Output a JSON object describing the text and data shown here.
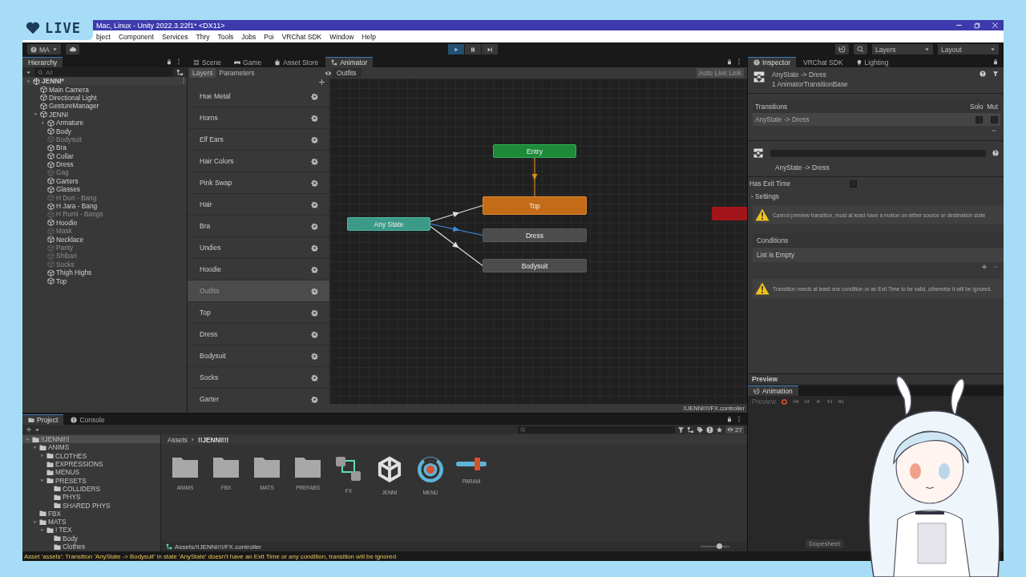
{
  "overlay": {
    "badge": "LIVE"
  },
  "window": {
    "title": "Mac, Linux - Unity 2022.3.22f1* <DX11>"
  },
  "menu": [
    "bject",
    "Component",
    "Services",
    "Thry",
    "Tools",
    "Jobs",
    "Poi",
    "VRChat SDK",
    "Window",
    "Help"
  ],
  "toolbar": {
    "account": "MA",
    "playing": true,
    "layers": "Layers",
    "layout": "Layout"
  },
  "hierarchy": {
    "tab": "Hierarchy",
    "search_placeholder": "All",
    "items": [
      {
        "label": "JENNI*",
        "kind": "scene",
        "expanded": true,
        "children": [
          {
            "label": "Main Camera",
            "active": true
          },
          {
            "label": "Directional Light",
            "active": true
          },
          {
            "label": "GestureManager",
            "active": true
          },
          {
            "label": "JENNI",
            "active": true,
            "expanded": true,
            "children": [
              {
                "label": "Armature",
                "active": true,
                "expanded": false
              },
              {
                "label": "Body",
                "active": true
              },
              {
                "label": "Bodysuit",
                "active": false
              },
              {
                "label": "Bra",
                "active": true
              },
              {
                "label": "Collar",
                "active": true
              },
              {
                "label": "Dress",
                "active": true
              },
              {
                "label": "Gag",
                "active": false
              },
              {
                "label": "Garters",
                "active": true
              },
              {
                "label": "Glasses",
                "active": true
              },
              {
                "label": "H Dori - Bang",
                "active": false
              },
              {
                "label": "H Jara - Bang",
                "active": true
              },
              {
                "label": "H Rumi - Bangs",
                "active": false
              },
              {
                "label": "Hoodie",
                "active": true
              },
              {
                "label": "Mask",
                "active": false
              },
              {
                "label": "Necklace",
                "active": true
              },
              {
                "label": "Panty",
                "active": false
              },
              {
                "label": "Shibari",
                "active": false
              },
              {
                "label": "Socks",
                "active": false
              },
              {
                "label": "Thigh Highs",
                "active": true
              },
              {
                "label": "Top",
                "active": true
              }
            ]
          }
        ]
      }
    ]
  },
  "animator": {
    "tabs": [
      {
        "label": "Scene",
        "selected": false
      },
      {
        "label": "Game",
        "selected": false
      },
      {
        "label": "Asset Store",
        "selected": false
      },
      {
        "label": "Animator",
        "selected": true
      }
    ],
    "subtabs": [
      {
        "label": "Layers",
        "selected": true
      },
      {
        "label": "Parameters",
        "selected": false
      }
    ],
    "breadcrumb": "Outfits",
    "live_link": "Auto Live Link",
    "layers": [
      {
        "name": "Hue Metal",
        "selected": false
      },
      {
        "name": "Horns",
        "selected": false
      },
      {
        "name": "Elf Ears",
        "selected": false
      },
      {
        "name": "Hair Colors",
        "selected": false
      },
      {
        "name": "Pink Swap",
        "selected": false
      },
      {
        "name": "Hair",
        "selected": false
      },
      {
        "name": "Bra",
        "selected": false
      },
      {
        "name": "Undies",
        "selected": false
      },
      {
        "name": "Hoodie",
        "selected": false
      },
      {
        "name": "Outfits",
        "selected": true
      },
      {
        "name": "Top",
        "selected": false
      },
      {
        "name": "Dress",
        "selected": false
      },
      {
        "name": "Bodysuit",
        "selected": false
      },
      {
        "name": "Socks",
        "selected": false
      },
      {
        "name": "Garter",
        "selected": false
      }
    ],
    "states": [
      {
        "name": "Entry",
        "kind": "entry"
      },
      {
        "name": "Top",
        "kind": "default"
      },
      {
        "name": "Dress",
        "kind": "state"
      },
      {
        "name": "Bodysuit",
        "kind": "state"
      },
      {
        "name": "Any State",
        "kind": "any"
      },
      {
        "kind": "exit"
      }
    ],
    "transitions": [
      {
        "selected": false
      },
      {
        "selected": false
      },
      {
        "selected": true
      },
      {
        "selected": false
      }
    ],
    "footer": "!!JENNI!!!/FX.controller"
  },
  "inspector": {
    "tabs": [
      {
        "label": "Inspector",
        "selected": true
      },
      {
        "label": "VRChat SDK",
        "selected": false
      },
      {
        "label": "Lighting",
        "selected": false
      }
    ],
    "title": "AnyState -> Dress",
    "subtitle": "1 AnimatorTransitionBase",
    "transitions": {
      "header": "Transitions",
      "solo": "Solo",
      "mute": "Mut",
      "rows": [
        {
          "label": "AnyState -> Dress",
          "solo": false,
          "mute": false
        }
      ]
    },
    "transition_name": "AnyState -> Dress",
    "has_exit_time": {
      "label": "Has Exit Time",
      "checked": false
    },
    "settings": {
      "label": "Settings",
      "expanded": false
    },
    "preview_warning": "Cannot preview transition, must at least have a motion on either source or destination state",
    "conditions": {
      "header": "Conditions",
      "empty": "List is Empty"
    },
    "condition_warning": "Transition needs at least one condition or an Exit Time to be valid, otherwise it will be ignored."
  },
  "preview": {
    "header": "Preview",
    "tab": "Animation",
    "label": "Preview",
    "dopesheet": "Dopesheet"
  },
  "project": {
    "tabs": [
      {
        "label": "Project",
        "selected": true
      },
      {
        "label": "Console",
        "selected": false
      }
    ],
    "hidden_count": "27",
    "tree": [
      {
        "label": "!!JENNI!!!",
        "selected": true,
        "expanded": true,
        "children": [
          {
            "label": "ANIMS",
            "selected": false,
            "expanded": true,
            "children": [
              {
                "label": "CLOTHES",
                "selected": false,
                "expanded": false
              },
              {
                "label": "EXPRESSIONS",
                "selected": false
              },
              {
                "label": "MENUS",
                "selected": false
              },
              {
                "label": "PRESETS",
                "selected": false,
                "expanded": true,
                "children": [
                  {
                    "label": "COLLIDERS",
                    "selected": false
                  },
                  {
                    "label": "PHYS",
                    "selected": false
                  },
                  {
                    "label": "SHARED PHYS",
                    "selected": false
                  }
                ]
              }
            ]
          },
          {
            "label": "FBX",
            "selected": false
          },
          {
            "label": "MATS",
            "selected": false,
            "expanded": true,
            "children": [
              {
                "label": "! TEX",
                "selected": false,
                "expanded": true,
                "children": [
                  {
                    "label": "Body",
                    "selected": false
                  },
                  {
                    "label": "Clothes",
                    "selected": false
                  }
                ]
              }
            ]
          }
        ]
      }
    ],
    "breadcrumb": [
      "Assets",
      "!!JENNI!!!"
    ],
    "assets": [
      {
        "label": "ANIMS",
        "kind": "folder"
      },
      {
        "label": "FBX",
        "kind": "folder"
      },
      {
        "label": "MATS",
        "kind": "folder"
      },
      {
        "label": "PREFABS",
        "kind": "folder"
      },
      {
        "label": "FX",
        "kind": "controller"
      },
      {
        "label": "JENNI",
        "kind": "prefab"
      },
      {
        "label": "MENU",
        "kind": "menu"
      },
      {
        "label": "PARAM",
        "kind": "parameters"
      }
    ],
    "path": "Assets/!!JENNI!!!/FX.controller",
    "icon_size": {
      "level": 0.65
    }
  },
  "status": "Asset 'assets': Transition 'AnyState -> Bodysuit' in state 'AnyState' doesn't have an Exit Time or any condition, transition will be ignored"
}
